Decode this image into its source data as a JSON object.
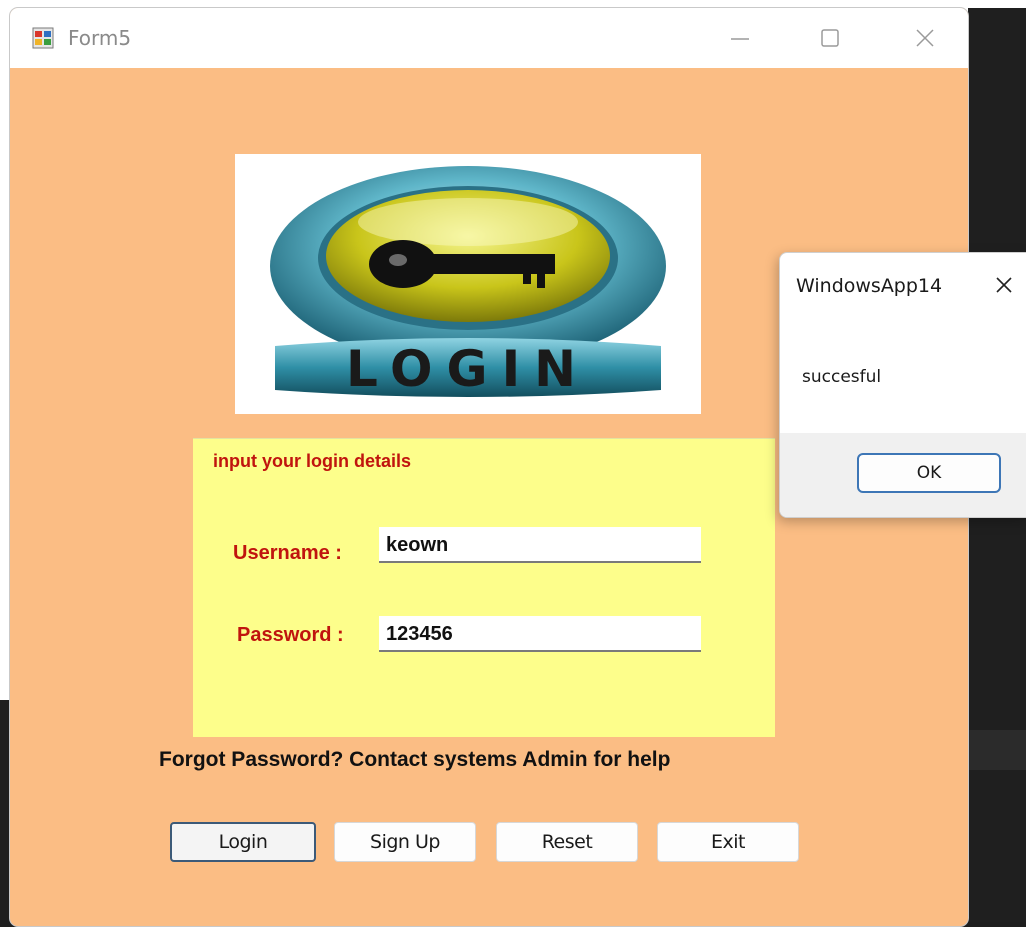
{
  "window": {
    "title": "Form5",
    "background_color": "#fbbd84"
  },
  "login_image": {
    "icon": "key-icon",
    "banner_text": "LOGIN"
  },
  "panel": {
    "caption": "input your login details",
    "background_color": "#fdfe8b",
    "username_label": "Username :",
    "username_value": "keown",
    "password_label": "Password :",
    "password_value": "123456"
  },
  "forgot_text": "Forgot Password? Contact systems Admin for help",
  "buttons": {
    "login": "Login",
    "signup": "Sign Up",
    "reset": "Reset",
    "exit": "Exit"
  },
  "message_box": {
    "title": "WindowsApp14",
    "message": "succesful",
    "ok_label": "OK"
  }
}
